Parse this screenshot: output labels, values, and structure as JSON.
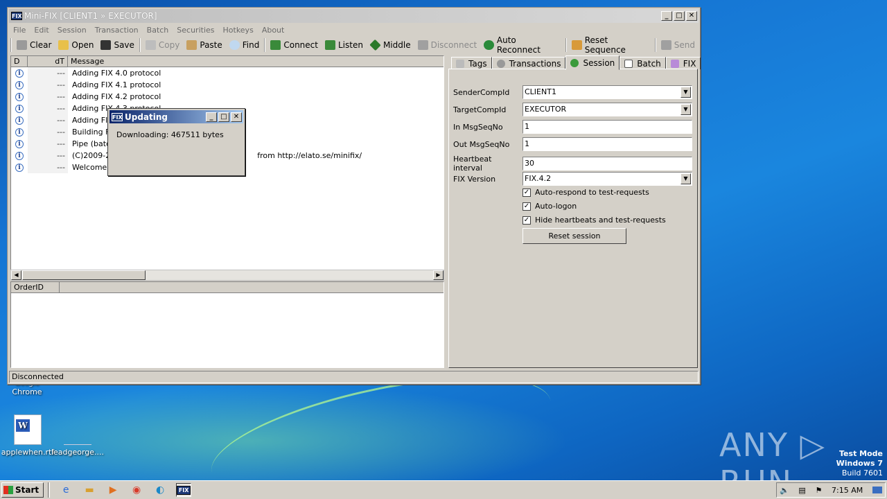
{
  "window": {
    "title": "Mini-FIX [CLIENT1 » EXECUTOR]",
    "app_icon": "FIX"
  },
  "menu": [
    "File",
    "Edit",
    "Session",
    "Transaction",
    "Batch",
    "Securities",
    "Hotkeys",
    "About"
  ],
  "toolbar": {
    "clear": "Clear",
    "open": "Open",
    "save": "Save",
    "copy": "Copy",
    "paste": "Paste",
    "find": "Find",
    "connect": "Connect",
    "listen": "Listen",
    "middle": "Middle",
    "disconnect": "Disconnect",
    "auto_reconnect": "Auto Reconnect",
    "reset_sequence": "Reset Sequence",
    "send": "Send"
  },
  "log": {
    "columns": [
      "D",
      "dT",
      "Message"
    ],
    "rows": [
      {
        "dt": "---",
        "msg": "Adding FIX 4.0 protocol"
      },
      {
        "dt": "---",
        "msg": "Adding FIX 4.1 protocol"
      },
      {
        "dt": "---",
        "msg": "Adding FIX 4.2 protocol"
      },
      {
        "dt": "---",
        "msg": "Adding FIX 4.3 protocol"
      },
      {
        "dt": "---",
        "msg": "Adding FIX"
      },
      {
        "dt": "---",
        "msg": "Building FIX"
      },
      {
        "dt": "---",
        "msg": "Pipe (batc"
      },
      {
        "dt": "---",
        "msg": "(C)2009-20"
      },
      {
        "dt": "---",
        "msg": "Welcome"
      }
    ],
    "row8_tail": "from http://elato.se/minifix/"
  },
  "orders": {
    "columns": [
      "OrderID"
    ]
  },
  "tabs": [
    "Tags",
    "Transactions",
    "Session",
    "Batch",
    "FIX"
  ],
  "session": {
    "sender_label": "SenderCompId",
    "sender_value": "CLIENT1",
    "target_label": "TargetCompId",
    "target_value": "EXECUTOR",
    "in_label": "In MsgSeqNo",
    "in_value": "1",
    "out_label": "Out MsgSeqNo",
    "out_value": "1",
    "hb_label": "Heartbeat interval",
    "hb_value": "30",
    "ver_label": "FIX Version",
    "ver_value": "FIX.4.2",
    "chk1": "Auto-respond to test-requests",
    "chk2": "Auto-logon",
    "chk3": "Hide heartbeats and test-requests",
    "reset_button": "Reset session"
  },
  "status": "Disconnected",
  "dialog": {
    "title": "Updating",
    "message": "Downloading: 467511 bytes"
  },
  "desktop": {
    "icon1": "applewhen.rtf",
    "icon2": "leadgeorge....",
    "chrome_label": "Google\nChrome",
    "anyrun": "ANY RUN",
    "testmode1": "Test Mode",
    "testmode2": "Windows 7",
    "testmode3": "Build 7601"
  },
  "taskbar": {
    "start": "Start",
    "clock": "7:15 AM"
  }
}
